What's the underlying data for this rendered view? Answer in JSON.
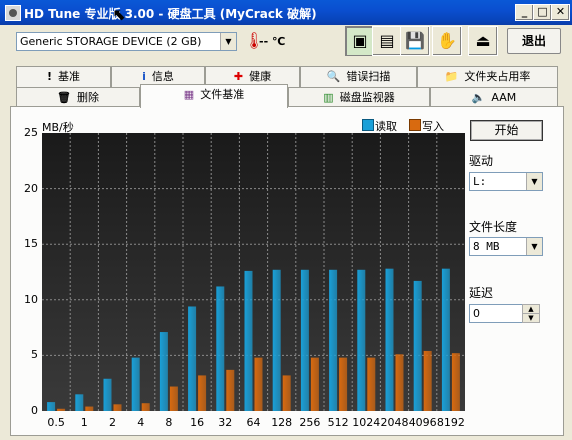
{
  "window": {
    "title": "HD Tune 专业版 3.00 - 硬盘工具 (MyCrack 破解)"
  },
  "toolbar": {
    "device": "Generic STORAGE DEVICE (2 GB)",
    "temperature": "-- ℃",
    "exit_label": "退出"
  },
  "tabs_row1": [
    {
      "label": "基准",
      "icon": "exclamation-icon"
    },
    {
      "label": "信息",
      "icon": "info-icon"
    },
    {
      "label": "健康",
      "icon": "health-cross-icon"
    },
    {
      "label": "错误扫描",
      "icon": "magnifier-icon"
    },
    {
      "label": "文件夹占用率",
      "icon": "folder-icon"
    }
  ],
  "tabs_row2": [
    {
      "label": "删除",
      "icon": "trash-icon"
    },
    {
      "label": "文件基准",
      "icon": "file-benchmark-icon",
      "selected": true
    },
    {
      "label": "磁盘监视器",
      "icon": "monitor-icon"
    },
    {
      "label": "AAM",
      "icon": "speaker-icon"
    }
  ],
  "panel": {
    "start_label": "开始",
    "drive_label": "驱动",
    "drive_value": "L:",
    "file_length_label": "文件长度",
    "file_length_value": "8 MB",
    "delay_label": "延迟",
    "delay_value": "0"
  },
  "colors": {
    "read": "#1aa0d8",
    "write": "#d86a10"
  },
  "chart_data": {
    "type": "bar",
    "ylabel": "MB/秒",
    "ylim": [
      0,
      25
    ],
    "yticks": [
      0,
      5,
      10,
      15,
      20,
      25
    ],
    "categories": [
      "0.5",
      "1",
      "2",
      "4",
      "8",
      "16",
      "32",
      "64",
      "128",
      "256",
      "512",
      "1024",
      "2048",
      "4096",
      "8192"
    ],
    "series": [
      {
        "name": "读取",
        "values": [
          0.8,
          1.5,
          2.9,
          4.8,
          7.1,
          9.4,
          11.2,
          12.6,
          12.7,
          12.7,
          12.7,
          12.7,
          12.8,
          11.7,
          12.8
        ]
      },
      {
        "name": "写入",
        "values": [
          0.2,
          0.4,
          0.6,
          0.7,
          2.2,
          3.2,
          3.7,
          4.8,
          3.2,
          4.8,
          4.8,
          4.8,
          5.1,
          5.4,
          5.2
        ]
      }
    ],
    "legend": "top-right",
    "grid": true
  }
}
